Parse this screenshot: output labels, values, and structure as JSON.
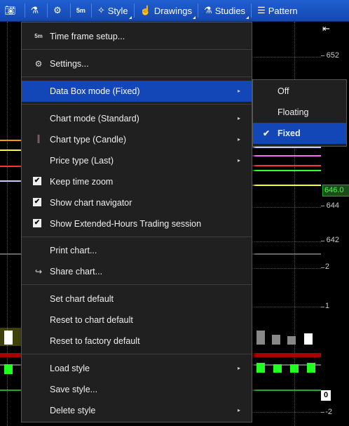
{
  "toolbar": {
    "items": [
      {
        "icon": "camera-icon"
      },
      {
        "icon": "flask-icon"
      },
      {
        "icon": "gear-icon"
      },
      {
        "label": "5m"
      },
      {
        "label": "Style",
        "icon": "style-icon"
      },
      {
        "label": "Drawings",
        "icon": "hand-icon"
      },
      {
        "label": "Studies",
        "icon": "flask-icon"
      },
      {
        "label": "Pattern",
        "icon": "pattern-icon"
      }
    ]
  },
  "axis": {
    "ticks": [
      "652",
      "646.0",
      "644",
      "642",
      "2",
      "1",
      "0",
      "-2"
    ]
  },
  "menu": {
    "timeframe_badge": "5m",
    "items": [
      {
        "label": "Time frame setup..."
      },
      {
        "label": "Settings..."
      },
      {
        "label": "Data Box mode (Fixed)"
      },
      {
        "label": "Chart mode (Standard)"
      },
      {
        "label": "Chart type (Candle)"
      },
      {
        "label": "Price type (Last)"
      },
      {
        "label": "Keep time zoom"
      },
      {
        "label": "Show chart navigator"
      },
      {
        "label": "Show Extended-Hours Trading session"
      },
      {
        "label": "Print chart..."
      },
      {
        "label": "Share chart..."
      },
      {
        "label": "Set chart default"
      },
      {
        "label": "Reset to chart default"
      },
      {
        "label": "Reset to factory default"
      },
      {
        "label": "Load style"
      },
      {
        "label": "Save style..."
      },
      {
        "label": "Delete style"
      }
    ]
  },
  "submenu": {
    "items": [
      {
        "label": "Off"
      },
      {
        "label": "Floating"
      },
      {
        "label": "Fixed",
        "selected": true
      }
    ]
  },
  "colors": {
    "accent": "#1347b8",
    "toolbar": "#1f5fd0",
    "menu_bg": "#202020"
  }
}
